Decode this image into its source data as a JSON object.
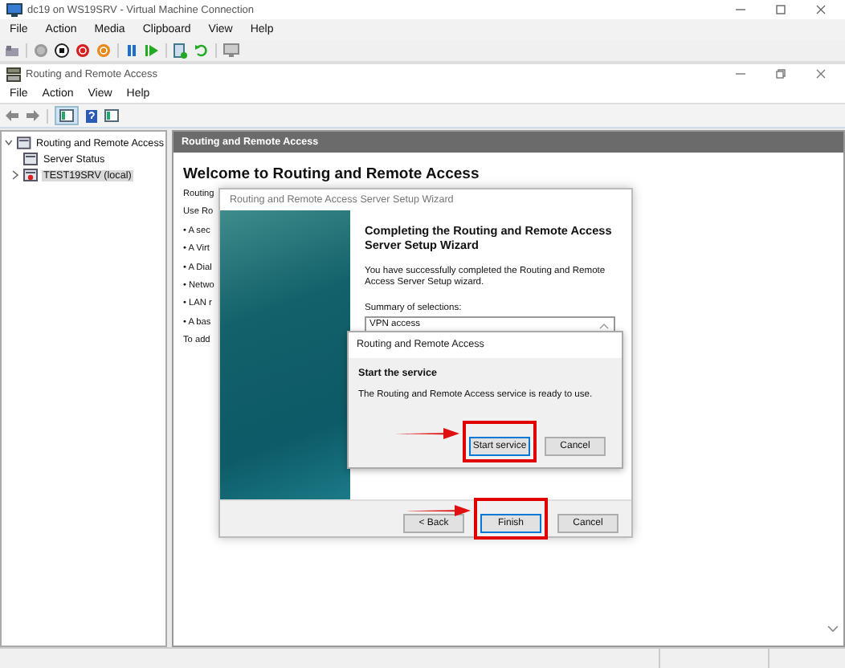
{
  "vm_window": {
    "title": "dc19 on WS19SRV - Virtual Machine Connection",
    "menu": [
      "File",
      "Action",
      "Media",
      "Clipboard",
      "View",
      "Help"
    ]
  },
  "mmc_window": {
    "title": "Routing and Remote Access",
    "menu": [
      "File",
      "Action",
      "View",
      "Help"
    ]
  },
  "tree": [
    {
      "label": "Routing and Remote Access",
      "selected": false,
      "expanded": true,
      "children": [
        {
          "label": "Server Status",
          "selected": false
        },
        {
          "label": "TEST19SRV (local)",
          "selected": true,
          "expanded": false
        }
      ]
    }
  ],
  "pane": {
    "header": "Routing and Remote Access",
    "heading": "Welcome to Routing and Remote Access",
    "lines": [
      "Routing",
      "Use Ro",
      "• A sec",
      "• A Virt",
      "• A Dial",
      "• Netwo",
      "• LAN r",
      "• A bas",
      "To add"
    ]
  },
  "wizard": {
    "title": "Routing and Remote Access Server Setup Wizard",
    "heading": "Completing the Routing and Remote Access Server Setup Wizard",
    "text": "You have successfully completed the Routing and Remote Access Server Setup wizard.",
    "summary_label": "Summary of selections:",
    "summary": "VPN access",
    "buttons": [
      {
        "label": "< Back",
        "highlighted": false
      },
      {
        "label": "Finish",
        "highlighted": true
      },
      {
        "label": "Cancel",
        "highlighted": false
      }
    ]
  },
  "message_box": {
    "title": "Routing and Remote Access",
    "heading": "Start the service",
    "text": "The Routing and Remote Access service is ready to use.",
    "buttons": [
      {
        "label": "Start service",
        "highlighted": true
      },
      {
        "label": "Cancel",
        "highlighted": false
      }
    ]
  }
}
